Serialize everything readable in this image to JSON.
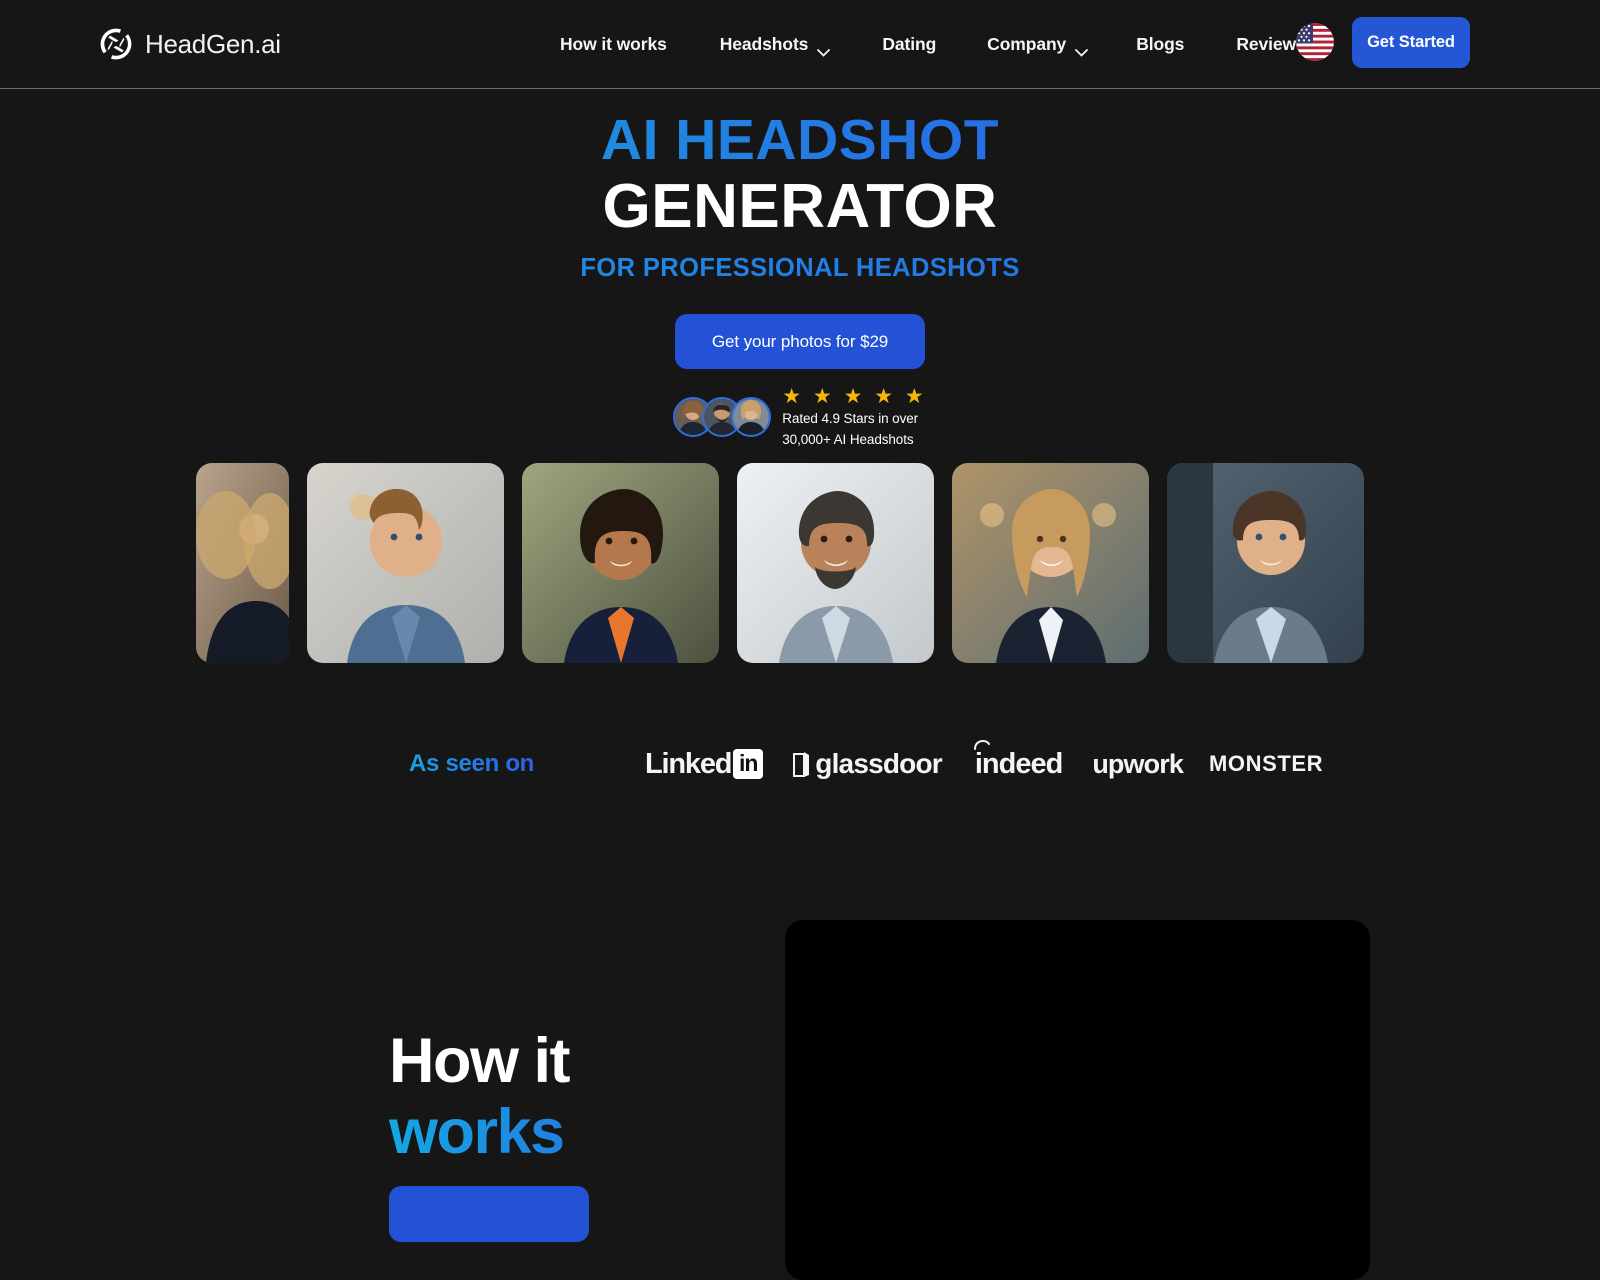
{
  "brand": {
    "name": "HeadGen.ai",
    "logo_icon": "aperture-icon"
  },
  "nav": {
    "items": [
      {
        "label": "How it works",
        "has_dropdown": false
      },
      {
        "label": "Headshots",
        "has_dropdown": true,
        "icon": "chevron-down-icon"
      },
      {
        "label": "Dating",
        "has_dropdown": false
      },
      {
        "label": "Company",
        "has_dropdown": true,
        "icon": "chevron-down-icon"
      },
      {
        "label": "Blogs",
        "has_dropdown": false
      },
      {
        "label": "Reviews",
        "has_dropdown": false
      }
    ],
    "locale_icon": "us-flag-icon",
    "cta_label": "Get Started"
  },
  "hero": {
    "title_line1": "AI HEADSHOT",
    "title_line2": "GENERATOR",
    "subtitle": "FOR PROFESSIONAL HEADSHOTS",
    "cta_label": "Get your photos for $29",
    "rating": {
      "stars_glyph": "★ ★ ★ ★ ★",
      "stars_count": 5,
      "line1": "Rated 4.9 Stars in over",
      "line2": "30,000+ AI Headshots",
      "score": "4.9",
      "count": "30,000+",
      "avatar_count": 3
    }
  },
  "gallery": {
    "items": [
      {
        "alt": "headshot-woman-blonde-partial",
        "clipped": true
      },
      {
        "alt": "headshot-man-curly-blue-shirt",
        "clipped": false
      },
      {
        "alt": "headshot-woman-curly-orange-top",
        "clipped": false
      },
      {
        "alt": "headshot-man-beard-gray-blazer",
        "clipped": false
      },
      {
        "alt": "headshot-woman-long-blonde-navy",
        "clipped": false
      },
      {
        "alt": "headshot-man-short-hair-gray-suit",
        "clipped": false
      }
    ]
  },
  "as_seen_on": {
    "label": "As seen on",
    "brands": [
      {
        "name": "LinkedIn",
        "text": "Linked",
        "mark": "in"
      },
      {
        "name": "glassdoor",
        "text": "glassdoor",
        "icon": "door-icon"
      },
      {
        "name": "indeed",
        "text": "indeed"
      },
      {
        "name": "upwork",
        "text": "upwork"
      },
      {
        "name": "Monster",
        "text": "MONSTER"
      }
    ]
  },
  "how_it_works": {
    "heading_line1": "How it",
    "heading_line2": "works",
    "cta_label": "",
    "video_placeholder": "video-player"
  },
  "colors": {
    "background": "#161616",
    "accent_blue": "#2452d6",
    "gradient_start": "#12a8e0",
    "gradient_end": "#2f4fe8",
    "star_gold": "#f5b50a",
    "text_primary": "#ffffff"
  }
}
